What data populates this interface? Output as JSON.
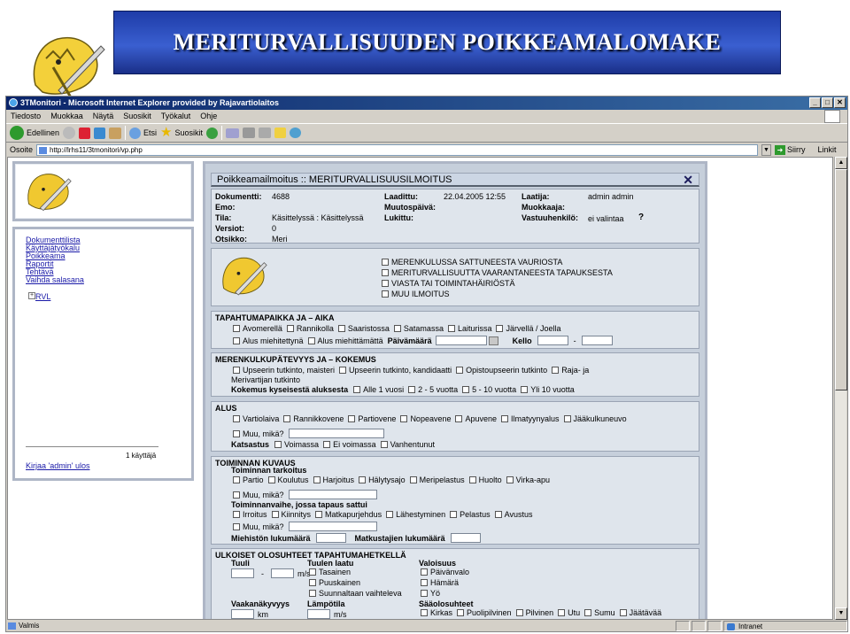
{
  "slide": {
    "title": "MERITURVALLISUUDEN POIKKEAMALOMAKE"
  },
  "window": {
    "title": "3TMonitori - Microsoft Internet Explorer provided by Rajavartiolaitos"
  },
  "menu": [
    "Tiedosto",
    "Muokkaa",
    "Näytä",
    "Suosikit",
    "Työkalut",
    "Ohje"
  ],
  "toolbar": {
    "back": "Edellinen",
    "search": "Etsi",
    "favorites": "Suosikit"
  },
  "address": {
    "url": "http://lrhs11/3tmonitori/vp.php",
    "go": "Siirry",
    "links": "Linkit"
  },
  "status": {
    "text": "Valmis",
    "zone": "Intranet"
  },
  "sidebar": {
    "links": [
      "Dokumenttilista",
      "Käyttäjätyökalu",
      "Poikkeama",
      "Raportit",
      "Tehtävä",
      "Vaihda salasana"
    ],
    "tree": "RVL",
    "users": "1 käyttäjä",
    "logout": "Kirjaa 'admin' ulos"
  },
  "form": {
    "header": "Poikkeamailmoitus :: MERITURVALLISUUSILMOITUS",
    "close": "✕",
    "meta": {
      "dokumentti_label": "Dokumentti:",
      "dokumentti": "4688",
      "laadittu_label": "Laadittu:",
      "laadittu": "22.04.2005 12:55",
      "laatija_label": "Laatija:",
      "laatija": "admin admin",
      "emo_label": "Emo:",
      "muutospaiva_label": "Muutospäivä:",
      "muokkaaja_label": "Muokkaaja:",
      "tila_label": "Tila:",
      "tila": "Käsittelyssä : Käsittelyssä",
      "lukittu_label": "Lukittu:",
      "vastuuhenkilo_label": "Vastuuhenkilö:",
      "vastuuhenkilo": "ei valintaa",
      "versiot_label": "Versiot:",
      "versiot": "0",
      "otsikko_label": "Otsikko:",
      "otsikko": "Meri"
    },
    "types": [
      "MERENKULUSSA SATTUNEESTA VAURIOSTA",
      "MERITURVALLISUUTTA VAARANTANEESTA TAPAUKSESTA",
      "VIASTA TAI TOIMINTAHÄIRIÖSTÄ",
      "MUU ILMOITUS"
    ],
    "place": {
      "title": "TAPAHTUMAPAIKKA JA – AIKA",
      "row1": [
        "Avomerellä",
        "Rannikolla",
        "Saaristossa",
        "Satamassa",
        "Laiturissa",
        "Järvellä / Joella"
      ],
      "row2": [
        "Alus miehitettynä",
        "Alus miehittämättä"
      ],
      "date_label": "Päivämäärä",
      "time_label": "Kello",
      "dash": "-"
    },
    "competence": {
      "title": "MERENKULKUPÄTEVYYS JA – KOKEMUS",
      "row1": [
        "Upseerin tutkinto, maisteri",
        "Upseerin tutkinto, kandidaatti",
        "Opistoupseerin tutkinto",
        "Raja- ja"
      ],
      "row1_cont": "Merivartijan tutkinto",
      "exp_label": "Kokemus kyseisestä aluksesta",
      "exp": [
        "Alle 1 vuosi",
        "2 - 5 vuotta",
        "5 - 10 vuotta",
        "Yli 10 vuotta"
      ]
    },
    "vessel": {
      "title": "ALUS",
      "row1": [
        "Vartiolaiva",
        "Rannikkovene",
        "Partiovene",
        "Nopeavene",
        "Apuvene",
        "Ilmatyynyalus",
        "Jääkulkuneuvo"
      ],
      "other": "Muu, mikä?",
      "inspection_label": "Katsastus",
      "inspection": [
        "Voimassa",
        "Ei voimassa",
        "Vanhentunut"
      ]
    },
    "operation": {
      "title": "TOIMINNAN KUVAUS",
      "purpose_label": "Toiminnan tarkoitus",
      "purpose": [
        "Partio",
        "Koulutus",
        "Harjoitus",
        "Hälytysajo",
        "Meripelastus",
        "Huolto",
        "Virka-apu"
      ],
      "other": "Muu, mikä?",
      "phase_label": "Toiminnanvaihe, jossa tapaus sattui",
      "phase": [
        "Irroitus",
        "Kiinnitys",
        "Matkapurjehdus",
        "Lähestyminen",
        "Pelastus",
        "Avustus"
      ],
      "crew_label": "Miehistön lukumäärä",
      "passengers_label": "Matkustajien lukumäärä"
    },
    "conditions": {
      "title": "ULKOISET OLOSUHTEET TAPAHTUMAHETKELLÄ",
      "wind_label": "Tuuli",
      "wind_unit": "m/s",
      "wind_dash": "-",
      "wind_quality_label": "Tuulen laatu",
      "wind_quality": [
        "Tasainen",
        "Puuskainen",
        "Suunnaltaan vaihteleva"
      ],
      "light_label": "Valoisuus",
      "light": [
        "Päivänvalo",
        "Hämärä",
        "Yö"
      ],
      "visibility_label": "Vaakanäkyvyys",
      "visibility_unit": "km",
      "temp_label": "Lämpötila",
      "temp_unit": "m/s",
      "weather_label": "Sääolosuhteet",
      "weather": [
        "Kirkas",
        "Puolipilvinen",
        "Pilvinen",
        "Utu",
        "Sumu",
        "Jäätävää"
      ]
    }
  }
}
